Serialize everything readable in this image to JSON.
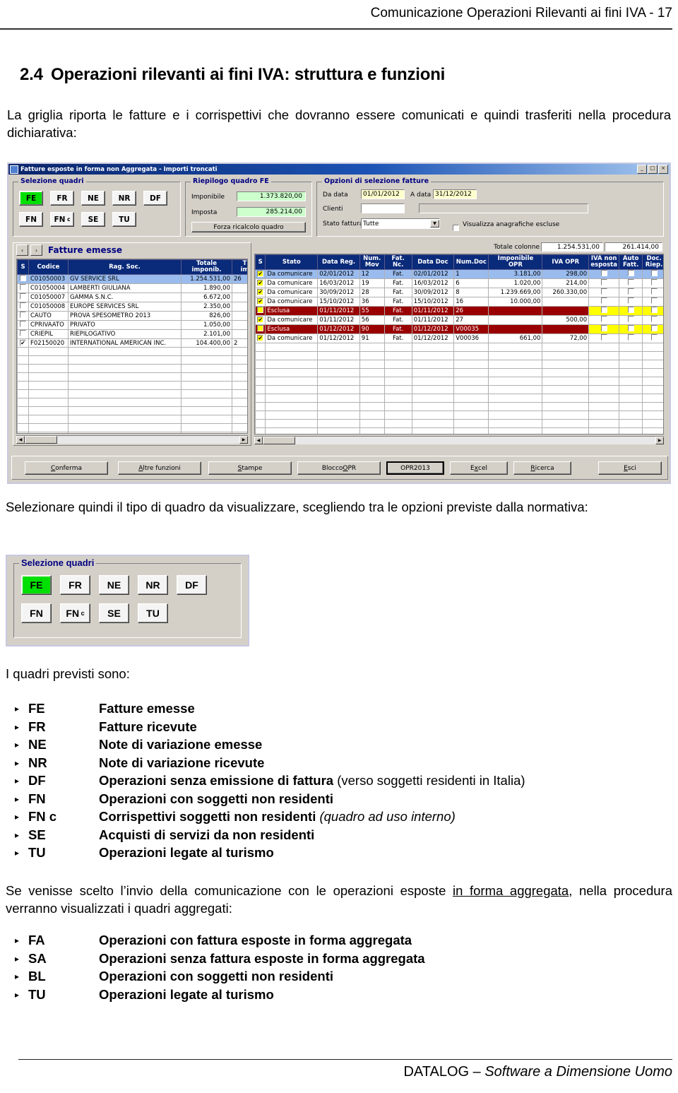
{
  "page": {
    "header": "Comunicazione Operazioni Rilevanti ai fini IVA - 17",
    "section_number": "2.4",
    "section_title": "Operazioni rilevanti ai fini IVA: struttura e funzioni",
    "paragraph_1": "La griglia riporta le fatture e i corrispettivi che dovranno essere comunicati e quindi trasferiti nella procedura dichiarativa:",
    "paragraph_2": "Selezionare quindi il tipo di quadro da visualizzare, scegliendo tra le opzioni previste dalla normativa:",
    "lead_quadri": "I quadri previsti sono:",
    "paragraph_3_a": "Se venisse scelto l’invio della comunicazione con le operazioni esposte ",
    "paragraph_3_underlined": "in forma aggregata",
    "paragraph_3_b": ", nella procedura verranno visualizzati i quadri aggregati:",
    "footer_brand": "DATALOG",
    "footer_dash": " – ",
    "footer_tagline": "Software a Dimensione Uomo"
  },
  "quadri_list": [
    {
      "code": "FE",
      "desc": "Fatture emesse",
      "extra": "",
      "extra_style": ""
    },
    {
      "code": "FR",
      "desc": "Fatture ricevute",
      "extra": "",
      "extra_style": ""
    },
    {
      "code": "NE",
      "desc": "Note di variazione emesse",
      "extra": "",
      "extra_style": ""
    },
    {
      "code": "NR",
      "desc": "Note di variazione ricevute",
      "extra": "",
      "extra_style": ""
    },
    {
      "code": "DF",
      "desc": "Operazioni senza emissione di fattura",
      "extra": "(verso soggetti residenti in Italia)",
      "extra_style": "paren"
    },
    {
      "code": "FN",
      "desc": "Operazioni con soggetti non residenti",
      "extra": "",
      "extra_style": ""
    },
    {
      "code": "FN c",
      "desc": "Corrispettivi soggetti non residenti",
      "extra": "(quadro ad uso interno)",
      "extra_style": "ital"
    },
    {
      "code": "SE",
      "desc": "Acquisti di servizi da non residenti",
      "extra": "",
      "extra_style": ""
    },
    {
      "code": "TU",
      "desc": "Operazioni legate al turismo",
      "extra": "",
      "extra_style": ""
    }
  ],
  "quadri_aggregati_list": [
    {
      "code": "FA",
      "desc": "Operazioni con fattura esposte in forma aggregata"
    },
    {
      "code": "SA",
      "desc": "Operazioni senza fattura esposte in forma aggregata"
    },
    {
      "code": "BL",
      "desc": "Operazioni con soggetti non residenti"
    },
    {
      "code": "TU",
      "desc": "Operazioni legate al turismo"
    }
  ],
  "app_window": {
    "title": "Fatture esposte in forma non Aggregata  -  Importi troncati",
    "window_buttons": {
      "minimize": "_",
      "maximize": "□",
      "close": "×"
    },
    "selezione_quadri": {
      "legend": "Selezione quadri",
      "buttons_row1": [
        "FE",
        "FR",
        "NE",
        "NR",
        "DF"
      ],
      "buttons_row2": [
        "FN",
        "FN c",
        "SE",
        "TU"
      ],
      "active": "FE"
    },
    "riepilogo": {
      "legend": "Riepilogo quadro FE",
      "imponibile_label": "Imponibile",
      "imponibile_value": "1.373.820,00",
      "imposta_label": "Imposta",
      "imposta_value": "285.214,00",
      "force_button": "Forza ricalcolo quadro"
    },
    "opzioni": {
      "legend": "Opzioni di selezione fatture",
      "da_data_label": "Da data",
      "da_data_value": "01/01/2012",
      "a_data_label": "A data",
      "a_data_value": "31/12/2012",
      "clienti_label": "Clienti",
      "clienti_value": "",
      "clienti_desc_value": "",
      "stato_fattura_label": "Stato fattura",
      "stato_fattura_value": "Tutte",
      "visualizza_label": "Visualizza anagrafiche escluse",
      "visualizza_checked": false
    },
    "left_panel": {
      "prev_arrow": "‹",
      "next_arrow": "›",
      "title": "Fatture emesse",
      "columns": [
        "S",
        "Codice",
        "Rag. Soc.",
        "Totale imponib.",
        "Totale imposta"
      ],
      "rows": [
        {
          "s": false,
          "codice": "C01050003",
          "ragsoc": "GV SERVICE SRL",
          "tot_imp": "1.254.531,00",
          "tot_iva": "26",
          "selected": true
        },
        {
          "s": false,
          "codice": "C01050004",
          "ragsoc": "LAMBERTI GIULIANA",
          "tot_imp": "1.890,00",
          "tot_iva": "",
          "selected": false
        },
        {
          "s": false,
          "codice": "C01050007",
          "ragsoc": "GAMMA S.N.C.",
          "tot_imp": "6.672,00",
          "tot_iva": "",
          "selected": false
        },
        {
          "s": false,
          "codice": "C01050008",
          "ragsoc": "EUROPE SERVICES SRL",
          "tot_imp": "2.350,00",
          "tot_iva": "",
          "selected": false
        },
        {
          "s": false,
          "codice": "CAUTO",
          "ragsoc": "PROVA SPESOMETRO 2013",
          "tot_imp": "826,00",
          "tot_iva": "",
          "selected": false
        },
        {
          "s": false,
          "codice": "CPRIVAATO",
          "ragsoc": "PRIVATO",
          "tot_imp": "1.050,00",
          "tot_iva": "",
          "selected": false
        },
        {
          "s": false,
          "codice": "CRIEPIL",
          "ragsoc": "RIEPILOGATIVO",
          "tot_imp": "2.101,00",
          "tot_iva": "",
          "selected": false
        },
        {
          "s": true,
          "codice": "F02150020",
          "ragsoc": "INTERNATIONAL AMERICAN INC.",
          "tot_imp": "104.400,00",
          "tot_iva": "2",
          "selected": false
        }
      ]
    },
    "right_panel": {
      "totale_colonne_label": "Totale colonne",
      "totale_colonne_1": "1.254.531,00",
      "totale_colonne_2": "261.414,00",
      "columns": [
        "S",
        "Stato",
        "Data Reg.",
        "Num. Mov",
        "Fat. Nc.",
        "Data Doc",
        "Num.Doc",
        "Imponibile OPR",
        "IVA OPR",
        "IVA non esposta",
        "Auto Fatt.",
        "Doc. Riep."
      ],
      "rows": [
        {
          "s": true,
          "stato": "Da comunicare",
          "data_reg": "02/01/2012",
          "num_mov": "12",
          "fat_nc": "Fat.",
          "data_doc": "02/01/2012",
          "num_doc": "1",
          "imponibile": "3.181,00",
          "iva": "298,00",
          "state": "selected"
        },
        {
          "s": true,
          "stato": "Da comunicare",
          "data_reg": "16/03/2012",
          "num_mov": "19",
          "fat_nc": "Fat.",
          "data_doc": "16/03/2012",
          "num_doc": "6",
          "imponibile": "1.020,00",
          "iva": "214,00",
          "state": "normal"
        },
        {
          "s": true,
          "stato": "Da comunicare",
          "data_reg": "30/09/2012",
          "num_mov": "28",
          "fat_nc": "Fat.",
          "data_doc": "30/09/2012",
          "num_doc": "8",
          "imponibile": "1.239.669,00",
          "iva": "260.330,00",
          "state": "normal"
        },
        {
          "s": true,
          "stato": "Da comunicare",
          "data_reg": "15/10/2012",
          "num_mov": "36",
          "fat_nc": "Fat.",
          "data_doc": "15/10/2012",
          "num_doc": "16",
          "imponibile": "10.000,00",
          "iva": "",
          "state": "yellow"
        },
        {
          "s": false,
          "stato": "Esclusa",
          "data_reg": "01/11/2012",
          "num_mov": "55",
          "fat_nc": "Fat.",
          "data_doc": "01/11/2012",
          "num_doc": "26",
          "imponibile": "",
          "iva": "",
          "state": "excluded"
        },
        {
          "s": true,
          "stato": "Da comunicare",
          "data_reg": "01/11/2012",
          "num_mov": "56",
          "fat_nc": "Fat.",
          "data_doc": "01/11/2012",
          "num_doc": "27",
          "imponibile": "",
          "iva": "500,00",
          "state": "normal"
        },
        {
          "s": false,
          "stato": "Esclusa",
          "data_reg": "01/12/2012",
          "num_mov": "90",
          "fat_nc": "Fat.",
          "data_doc": "01/12/2012",
          "num_doc": "V00035",
          "imponibile": "",
          "iva": "",
          "state": "excluded"
        },
        {
          "s": true,
          "stato": "Da comunicare",
          "data_reg": "01/12/2012",
          "num_mov": "91",
          "fat_nc": "Fat.",
          "data_doc": "01/12/2012",
          "num_doc": "V00036",
          "imponibile": "661,00",
          "iva": "72,00",
          "state": "normal"
        }
      ]
    },
    "bottom_buttons": [
      {
        "label": "Conferma",
        "accel": "C",
        "focused": false
      },
      {
        "label": "Altre funzioni",
        "accel": "A",
        "focused": false
      },
      {
        "label": "Stampe",
        "accel": "S",
        "focused": false
      },
      {
        "label": "Blocco OPR",
        "accel": "O",
        "focused": false
      },
      {
        "label": "OPR2013",
        "accel": "",
        "focused": true
      },
      {
        "label": "Excel",
        "accel": "x",
        "focused": false
      },
      {
        "label": "Ricerca",
        "accel": "R",
        "focused": false
      },
      {
        "label": "Esci",
        "accel": "E",
        "focused": false
      }
    ]
  },
  "quad_selector_shot": {
    "legend": "Selezione quadri",
    "buttons_row1": [
      "FE",
      "FR",
      "NE",
      "NR",
      "DF"
    ],
    "buttons_row2": [
      "FN",
      "FN c",
      "SE",
      "TU"
    ],
    "active": "FE"
  },
  "colors": {
    "titlebar_start": "#0a246a",
    "titlebar_end": "#a6c8f0",
    "face": "#d4d0c8",
    "active_quad": "#00e000",
    "grid_header": "#0a2a7a",
    "row_selected": "#99bbee",
    "row_excluded": "#990000",
    "highlight_yellow": "#ffff00",
    "green_field": "#ccffcc",
    "yellow_field": "#ffffcc",
    "legend_text": "#000080"
  }
}
